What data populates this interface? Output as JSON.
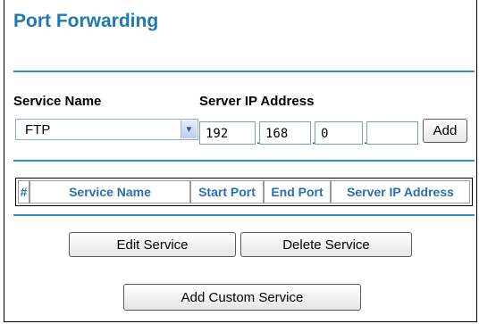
{
  "header": {
    "title": "Port Forwarding"
  },
  "form": {
    "service_name_label": "Service Name",
    "server_ip_label": "Server IP Address",
    "service_selected": "FTP",
    "ip": [
      "192",
      "168",
      "0",
      ""
    ],
    "add_label": "Add"
  },
  "table": {
    "columns": [
      "#",
      "Service Name",
      "Start Port",
      "End Port",
      "Server IP Address"
    ]
  },
  "actions": {
    "edit_service": "Edit Service",
    "delete_service": "Delete Service",
    "add_custom_service": "Add Custom Service"
  },
  "colors": {
    "accent": "#1f77b4",
    "rule": "#2e8fc6"
  }
}
